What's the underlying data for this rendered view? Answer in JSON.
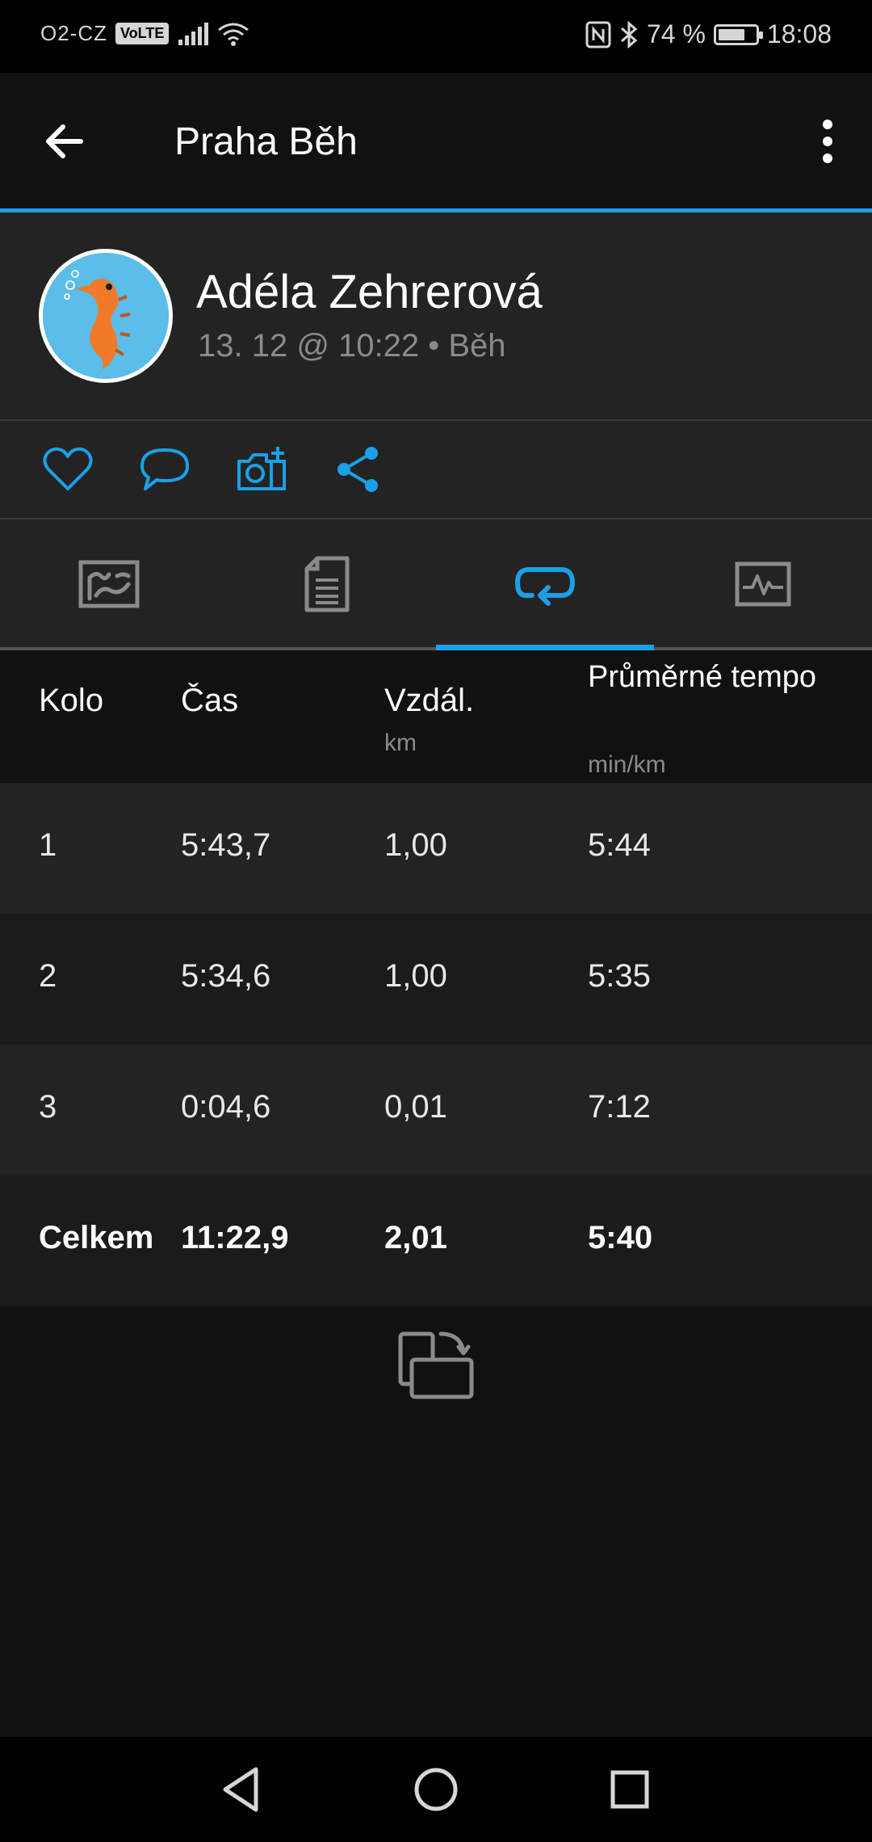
{
  "status_bar": {
    "carrier": "O2-CZ",
    "volte": "VoLTE",
    "battery_text": "74 %",
    "battery_level": 0.74,
    "time": "18:08"
  },
  "toolbar": {
    "title": "Praha Běh"
  },
  "profile": {
    "name": "Adéla Zehrerová",
    "meta": "13. 12 @ 10:22 • Běh"
  },
  "colors": {
    "accent": "#1aa0e8",
    "background": "#111111",
    "panel": "#232323",
    "row_alt": "#1b1b1b"
  },
  "tabs": [
    {
      "icon": "map-icon",
      "active": false
    },
    {
      "icon": "details-icon",
      "active": false
    },
    {
      "icon": "laps-icon",
      "active": true
    },
    {
      "icon": "charts-icon",
      "active": false
    }
  ],
  "table": {
    "headers": {
      "lap": "Kolo",
      "time": "Čas",
      "distance": "Vzdál.",
      "distance_unit": "km",
      "pace": "Průměrné tempo",
      "pace_unit": "min/km"
    },
    "rows": [
      {
        "lap": "1",
        "time": "5:43,7",
        "distance": "1,00",
        "pace": "5:44"
      },
      {
        "lap": "2",
        "time": "5:34,6",
        "distance": "1,00",
        "pace": "5:35"
      },
      {
        "lap": "3",
        "time": "0:04,6",
        "distance": "0,01",
        "pace": "7:12"
      }
    ],
    "total": {
      "lap": "Celkem",
      "time": "11:22,9",
      "distance": "2,01",
      "pace": "5:40"
    }
  }
}
